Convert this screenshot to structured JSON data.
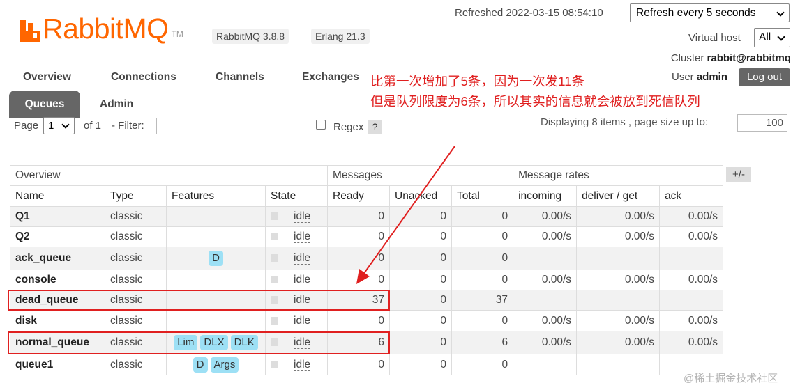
{
  "header": {
    "logo_text": "RabbitMQ",
    "logo_tm": "TM",
    "rabbitmq_version": "RabbitMQ 3.8.8",
    "erlang_version": "Erlang 21.3",
    "refreshed": "Refreshed 2022-03-15 08:54:10",
    "refresh_interval": "Refresh every 5 seconds",
    "virtual_host_label": "Virtual host",
    "virtual_host_value": "All",
    "cluster_label": "Cluster",
    "cluster_name": "rabbit@rabbitmq",
    "user_label": "User",
    "user_name": "admin",
    "logout_label": "Log out"
  },
  "nav": {
    "overview": "Overview",
    "connections": "Connections",
    "channels": "Channels",
    "exchanges": "Exchanges",
    "queues": "Queues",
    "admin": "Admin",
    "active": "Queues"
  },
  "filter": {
    "page_label": "Page",
    "page_value": "1",
    "of_label": "of 1",
    "filter_label": "- Filter:",
    "filter_value": "",
    "regex_label": "Regex",
    "regex_help": "?",
    "displaying": "Displaying 8 items , page size up to:",
    "page_size": "100"
  },
  "table": {
    "groups": {
      "overview": "Overview",
      "messages": "Messages",
      "message_rates": "Message rates"
    },
    "columns": [
      "Name",
      "Type",
      "Features",
      "State",
      "Ready",
      "Unacked",
      "Total",
      "incoming",
      "deliver / get",
      "ack"
    ],
    "toggle_columns": "+/-",
    "rows": [
      {
        "name": "Q1",
        "type": "classic",
        "features": [],
        "state": "idle",
        "ready": "0",
        "unacked": "0",
        "total": "0",
        "incoming": "0.00/s",
        "deliver_get": "0.00/s",
        "ack": "0.00/s"
      },
      {
        "name": "Q2",
        "type": "classic",
        "features": [],
        "state": "idle",
        "ready": "0",
        "unacked": "0",
        "total": "0",
        "incoming": "0.00/s",
        "deliver_get": "0.00/s",
        "ack": "0.00/s"
      },
      {
        "name": "ack_queue",
        "type": "classic",
        "features": [
          "D"
        ],
        "state": "idle",
        "ready": "0",
        "unacked": "0",
        "total": "0",
        "incoming": "",
        "deliver_get": "",
        "ack": ""
      },
      {
        "name": "console",
        "type": "classic",
        "features": [],
        "state": "idle",
        "ready": "0",
        "unacked": "0",
        "total": "0",
        "incoming": "0.00/s",
        "deliver_get": "0.00/s",
        "ack": "0.00/s"
      },
      {
        "name": "dead_queue",
        "type": "classic",
        "features": [],
        "state": "idle",
        "ready": "37",
        "unacked": "0",
        "total": "37",
        "incoming": "",
        "deliver_get": "",
        "ack": ""
      },
      {
        "name": "disk",
        "type": "classic",
        "features": [],
        "state": "idle",
        "ready": "0",
        "unacked": "0",
        "total": "0",
        "incoming": "0.00/s",
        "deliver_get": "0.00/s",
        "ack": "0.00/s"
      },
      {
        "name": "normal_queue",
        "type": "classic",
        "features": [
          "Lim",
          "DLX",
          "DLK"
        ],
        "state": "idle",
        "ready": "6",
        "unacked": "0",
        "total": "6",
        "incoming": "0.00/s",
        "deliver_get": "0.00/s",
        "ack": "0.00/s"
      },
      {
        "name": "queue1",
        "type": "classic",
        "features": [
          "D",
          "Args"
        ],
        "state": "idle",
        "ready": "0",
        "unacked": "0",
        "total": "0",
        "incoming": "",
        "deliver_get": "",
        "ack": ""
      }
    ]
  },
  "annotation": {
    "line1": "比第一次增加了5条，因为一次发11条",
    "line2": "但是队列限度为6条，所以其实的信息就会被放到死信队列",
    "color": "#e02020"
  },
  "watermark": "@稀土掘金技术社区",
  "colors": {
    "brand": "#ff6600",
    "tab_active": "#666666",
    "feature_badge": "#9de0f5"
  }
}
